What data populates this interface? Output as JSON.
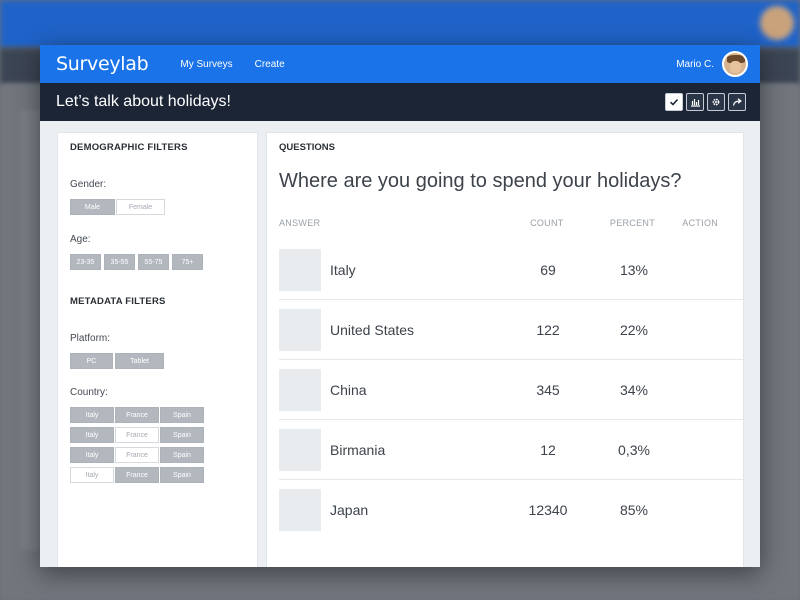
{
  "app": {
    "logo": "Surveylab"
  },
  "nav": {
    "items": [
      "My Surveys",
      "Create"
    ]
  },
  "user": {
    "name": "Mario C."
  },
  "survey": {
    "title": "Let’s talk about holidays!"
  },
  "toolbar": {
    "icons": [
      "check-icon",
      "chart-icon",
      "gear-icon",
      "share-icon"
    ]
  },
  "filters": {
    "demographic_heading": "DEMOGRAPHIC FILTERS",
    "gender_label": "Gender:",
    "gender_options": [
      {
        "label": "Male",
        "selected": true
      },
      {
        "label": "Female",
        "selected": false
      }
    ],
    "age_label": "Age:",
    "age_options": [
      {
        "label": "23-35",
        "selected": true
      },
      {
        "label": "35-55",
        "selected": true
      },
      {
        "label": "55-75",
        "selected": true
      },
      {
        "label": "75+",
        "selected": true
      }
    ],
    "metadata_heading": "METADATA FILTERS",
    "platform_label": "Platform:",
    "platform_options": [
      {
        "label": "PC",
        "selected": true
      },
      {
        "label": "Tablet",
        "selected": true
      }
    ],
    "country_label": "Country:",
    "country_rows": [
      [
        {
          "label": "Italy",
          "selected": true
        },
        {
          "label": "France",
          "selected": true
        },
        {
          "label": "Spain",
          "selected": true
        }
      ],
      [
        {
          "label": "Italy",
          "selected": true
        },
        {
          "label": "France",
          "selected": false
        },
        {
          "label": "Spain",
          "selected": true
        }
      ],
      [
        {
          "label": "Italy",
          "selected": true
        },
        {
          "label": "France",
          "selected": false
        },
        {
          "label": "Spain",
          "selected": true
        }
      ],
      [
        {
          "label": "Italy",
          "selected": false
        },
        {
          "label": "France",
          "selected": true
        },
        {
          "label": "Spain",
          "selected": true
        }
      ]
    ]
  },
  "questions": {
    "heading": "QUESTIONS",
    "question": "Where are you going to spend your holidays?",
    "columns": {
      "answer": "ANSWER",
      "count": "COUNT",
      "percent": "PERCENT",
      "action": "ACTION"
    },
    "answers": [
      {
        "label": "Italy",
        "count": "69",
        "percent": "13%"
      },
      {
        "label": "United States",
        "count": "122",
        "percent": "22%"
      },
      {
        "label": "China",
        "count": "345",
        "percent": "34%"
      },
      {
        "label": "Birmania",
        "count": "12",
        "percent": "0,3%"
      },
      {
        "label": "Japan",
        "count": "12340",
        "percent": "85%"
      }
    ]
  }
}
